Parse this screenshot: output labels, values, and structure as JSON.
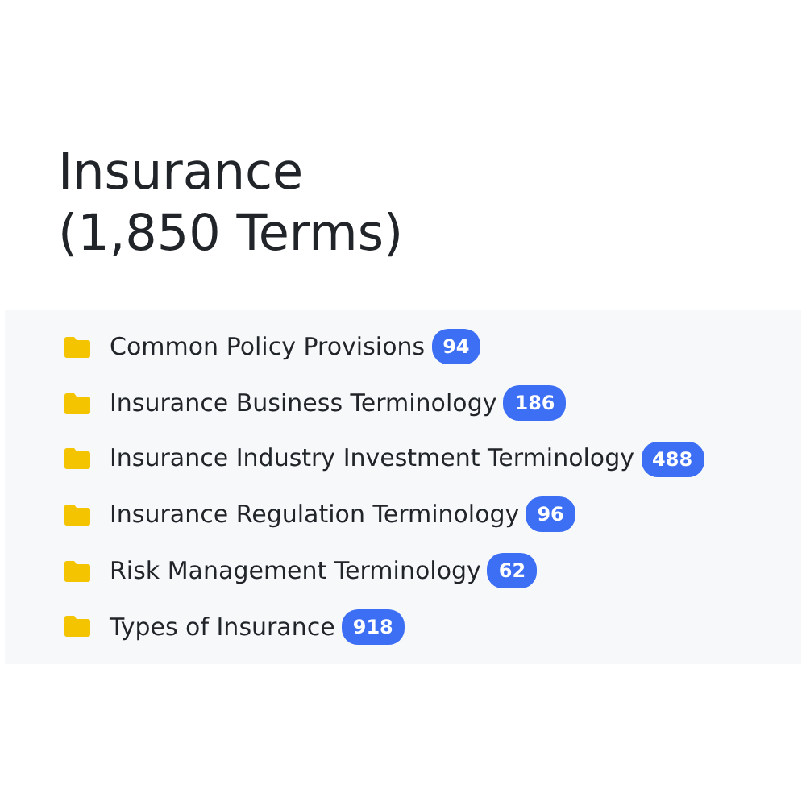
{
  "title": "Insurance",
  "subtitle": "(1,850 Terms)",
  "categories": [
    {
      "label": "Common Policy Provisions",
      "count": "94"
    },
    {
      "label": "Insurance Business Terminology",
      "count": "186"
    },
    {
      "label": "Insurance Industry Investment Terminology",
      "count": "488"
    },
    {
      "label": "Insurance Regulation Terminology",
      "count": "96"
    },
    {
      "label": "Risk Management Terminology",
      "count": "62"
    },
    {
      "label": "Types of Insurance",
      "count": "918"
    }
  ]
}
